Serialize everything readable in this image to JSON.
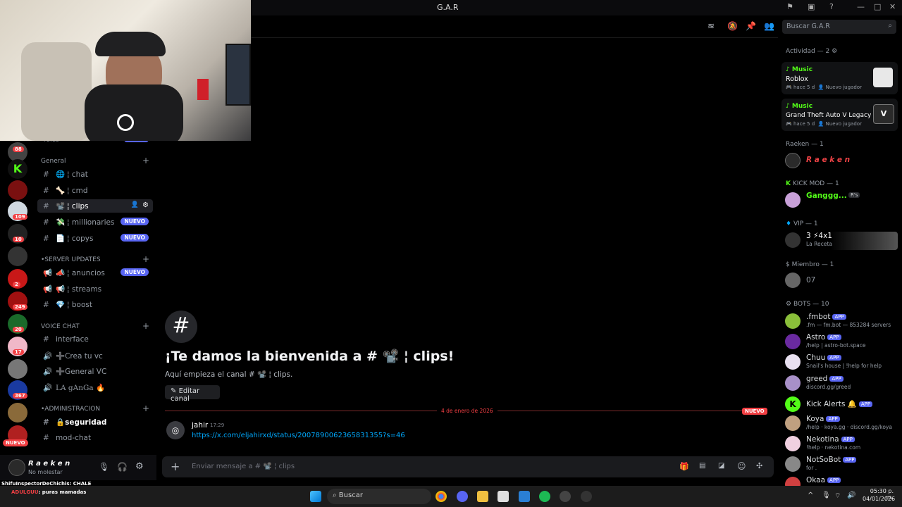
{
  "window": {
    "title": "G.A.R"
  },
  "channels": {
    "partial_top": "roles",
    "partial_top_badge": "NUEVO",
    "general": {
      "label": "General",
      "items": [
        {
          "emoji": "🌐",
          "name": "¦ chat"
        },
        {
          "emoji": "🦴",
          "name": "¦ cmd"
        },
        {
          "emoji": "📽️",
          "name": "¦ clips",
          "selected": true
        },
        {
          "emoji": "💸",
          "name": "¦ millionaries",
          "badge": "NUEVO"
        },
        {
          "emoji": "📄",
          "name": "¦ copys",
          "badge": "NUEVO"
        }
      ]
    },
    "updates": {
      "label": "•SERVER UPDATES",
      "items": [
        {
          "emoji": "📣",
          "name": "¦ anuncios",
          "badge": "NUEVO"
        },
        {
          "emoji": "📢",
          "name": "¦ streams"
        },
        {
          "emoji": "💎",
          "name": "¦ boost"
        }
      ]
    },
    "voice": {
      "label": "VOICE CHAT",
      "items": [
        {
          "name": "interface",
          "type": "text"
        },
        {
          "name": "➕Crea tu vc",
          "type": "voice"
        },
        {
          "name": "➕General VC",
          "type": "voice"
        },
        {
          "name": "LA gAnGa 🔥",
          "type": "voice"
        }
      ]
    },
    "admin": {
      "label": "•ADMINISTRACION",
      "items": [
        {
          "name": "🔒seguridad",
          "bold": true
        },
        {
          "name": "mod-chat"
        }
      ]
    }
  },
  "servers": {
    "badges": [
      "88",
      "109",
      "10",
      "2",
      "249",
      "20",
      "17",
      "367"
    ],
    "nuevo": "NUEVO"
  },
  "user": {
    "name": "R a e k e n",
    "status": "No molestar"
  },
  "chat": {
    "welcome_title": "¡Te damos la bienvenida a # 📽️ ¦ clips!",
    "welcome_sub": "Aquí empieza el canal # 📽️ ¦ clips.",
    "edit_button": "Editar canal",
    "divider_date": "4 de enero de 2026",
    "divider_new": "NUEVO",
    "message": {
      "author": "jahir",
      "time": "17:29",
      "text": "https://x.com/eljahirxd/status/2007890062365831355?s=46"
    },
    "composer_placeholder": "Enviar mensaje a # 📽️ ¦ clips"
  },
  "search": {
    "placeholder": "Buscar G.A.R"
  },
  "activity": {
    "header": "Actividad — 2",
    "cards": [
      {
        "tag": "Music",
        "game": "Roblox",
        "time": "hace 5 d",
        "note": "Nuevo jugador"
      },
      {
        "tag": "Music",
        "game": "Grand Theft Auto V Legacy",
        "time": "hace 5 d",
        "note": "Nuevo jugador"
      }
    ]
  },
  "members": {
    "sections": [
      {
        "title": "Raeken — 1",
        "members": [
          {
            "name": "R a e k e n",
            "color": "#ed4245",
            "sub": ""
          }
        ]
      },
      {
        "title": "KICK MOD — 1",
        "members": [
          {
            "name": "Ganggg...",
            "color": "#53fc18",
            "sub": "",
            "tag": "R's"
          }
        ]
      },
      {
        "title": "VIP — 1",
        "members": [
          {
            "name": "3 ⚡4x1",
            "color": "#dbdee1",
            "sub": "La Receta"
          }
        ]
      },
      {
        "title": "Miembro — 1",
        "members": [
          {
            "name": "07",
            "color": "#949ba4",
            "sub": ""
          }
        ]
      },
      {
        "title": "BOTS — 10",
        "members": [
          {
            "name": ".fmbot",
            "color": "#dbdee1",
            "sub": ".fm — fm.bot — 853284 servers",
            "app": "APP"
          },
          {
            "name": "Astro",
            "color": "#dbdee1",
            "sub": "/help | astro-bot.space",
            "app": "APP"
          },
          {
            "name": "Chuu",
            "color": "#dbdee1",
            "sub": "Snail's house | !help for help",
            "app": "APP"
          },
          {
            "name": "greed",
            "color": "#dbdee1",
            "sub": "discord.gg/greed",
            "app": "APP"
          },
          {
            "name": "Kick Alerts 🔔",
            "color": "#dbdee1",
            "sub": "",
            "app": "APP"
          },
          {
            "name": "Koya",
            "color": "#dbdee1",
            "sub": "/help · koya.gg · discord.gg/koya",
            "app": "APP"
          },
          {
            "name": "Nekotina",
            "color": "#dbdee1",
            "sub": "!help · nekotina.com",
            "app": "APP"
          },
          {
            "name": "NotSoBot",
            "color": "#dbdee1",
            "sub": "for .",
            "app": "APP"
          },
          {
            "name": "Okaa",
            "color": "#dbdee1",
            "sub": "",
            "app": "APP"
          }
        ]
      }
    ]
  },
  "stream_chat": [
    {
      "user": "ShifuInspectorDeChichis",
      "text": ": CHALE"
    },
    {
      "user": "ADULGUU",
      "text": ": puras mamadas"
    }
  ],
  "taskbar": {
    "search": "Buscar",
    "time": "05:30 p. m.",
    "date": "04/01/2026"
  }
}
